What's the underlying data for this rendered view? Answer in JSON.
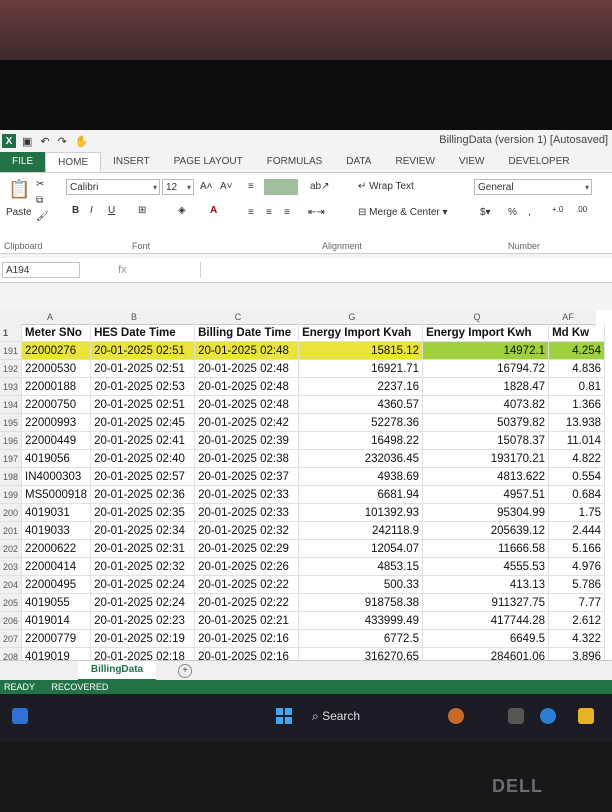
{
  "window": {
    "title": "BillingData (version 1) [Autosaved]"
  },
  "ribbon_tabs": [
    "FILE",
    "HOME",
    "INSERT",
    "PAGE LAYOUT",
    "FORMULAS",
    "DATA",
    "REVIEW",
    "VIEW",
    "DEVELOPER"
  ],
  "ribbon": {
    "clipboard_label": "Clipboard",
    "paste_label": "Paste",
    "font_label": "Font",
    "font_name": "Calibri",
    "font_size": "12",
    "alignment_label": "Alignment",
    "wrap_text": "Wrap Text",
    "merge_center": "Merge & Center",
    "number_label": "Number",
    "number_format": "General",
    "percent": "%"
  },
  "formula_bar": {
    "name_box": "A194",
    "fx": "fx"
  },
  "columns": [
    "A",
    "B",
    "C",
    "G",
    "Q",
    "AF"
  ],
  "headers": [
    "Meter SNo",
    "HES Date Time",
    "Billing Date Time",
    "Energy Import Kvah",
    "Energy Import Kwh",
    "Md Kw"
  ],
  "rows": [
    {
      "rn": "191",
      "cells": [
        "22000276",
        "20-01-2025 02:51",
        "20-01-2025 02:48",
        "15815.12",
        "14972.1",
        "4.254"
      ]
    },
    {
      "rn": "192",
      "cells": [
        "22000530",
        "20-01-2025 02:51",
        "20-01-2025 02:48",
        "16921.71",
        "16794.72",
        "4.836"
      ]
    },
    {
      "rn": "193",
      "cells": [
        "22000188",
        "20-01-2025 02:53",
        "20-01-2025 02:48",
        "2237.16",
        "1828.47",
        "0.81"
      ]
    },
    {
      "rn": "194",
      "cells": [
        "22000750",
        "20-01-2025 02:51",
        "20-01-2025 02:48",
        "4360.57",
        "4073.82",
        "1.366"
      ]
    },
    {
      "rn": "195",
      "cells": [
        "22000993",
        "20-01-2025 02:45",
        "20-01-2025 02:42",
        "52278.36",
        "50379.82",
        "13.938"
      ]
    },
    {
      "rn": "196",
      "cells": [
        "22000449",
        "20-01-2025 02:41",
        "20-01-2025 02:39",
        "16498.22",
        "15078.37",
        "11.014"
      ]
    },
    {
      "rn": "197",
      "cells": [
        "4019056",
        "20-01-2025 02:40",
        "20-01-2025 02:38",
        "232036.45",
        "193170.21",
        "4.822"
      ]
    },
    {
      "rn": "198",
      "cells": [
        "IN4000303",
        "20-01-2025 02:57",
        "20-01-2025 02:37",
        "4938.69",
        "4813.622",
        "0.554"
      ]
    },
    {
      "rn": "199",
      "cells": [
        "MS5000918",
        "20-01-2025 02:36",
        "20-01-2025 02:33",
        "6681.94",
        "4957.51",
        "0.684"
      ]
    },
    {
      "rn": "200",
      "cells": [
        "4019031",
        "20-01-2025 02:35",
        "20-01-2025 02:33",
        "101392.93",
        "95304.99",
        "1.75"
      ]
    },
    {
      "rn": "201",
      "cells": [
        "4019033",
        "20-01-2025 02:34",
        "20-01-2025 02:32",
        "242118.9",
        "205639.12",
        "2.444"
      ]
    },
    {
      "rn": "202",
      "cells": [
        "22000622",
        "20-01-2025 02:31",
        "20-01-2025 02:29",
        "12054.07",
        "11666.58",
        "5.166"
      ]
    },
    {
      "rn": "203",
      "cells": [
        "22000414",
        "20-01-2025 02:32",
        "20-01-2025 02:26",
        "4853.15",
        "4555.53",
        "4.976"
      ]
    },
    {
      "rn": "204",
      "cells": [
        "22000495",
        "20-01-2025 02:24",
        "20-01-2025 02:22",
        "500.33",
        "413.13",
        "5.786"
      ]
    },
    {
      "rn": "205",
      "cells": [
        "4019055",
        "20-01-2025 02:24",
        "20-01-2025 02:22",
        "918758.38",
        "911327.75",
        "7.77"
      ]
    },
    {
      "rn": "206",
      "cells": [
        "4019014",
        "20-01-2025 02:23",
        "20-01-2025 02:21",
        "433999.49",
        "417744.28",
        "2.612"
      ]
    },
    {
      "rn": "207",
      "cells": [
        "22000779",
        "20-01-2025 02:19",
        "20-01-2025 02:16",
        "6772.5",
        "6649.5",
        "4.322"
      ]
    },
    {
      "rn": "208",
      "cells": [
        "4019019",
        "20-01-2025 02:18",
        "20-01-2025 02:16",
        "316270.65",
        "284601.06",
        "3.896"
      ]
    }
  ],
  "sheet_tab": "BillingData",
  "status": {
    "ready": "READY",
    "recovered": "RECOVERED"
  },
  "taskbar": {
    "search": "Search"
  },
  "brand": "DELL",
  "colors": {
    "excel_green": "#217346",
    "highlight_yellow": "#e9e33a",
    "highlight_green": "#9fd13c"
  }
}
